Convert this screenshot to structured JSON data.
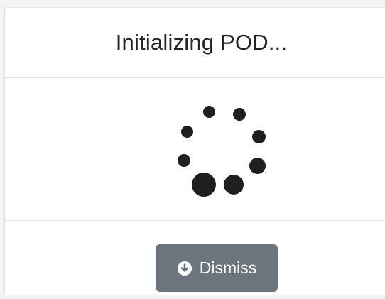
{
  "modal": {
    "title": "Initializing POD...",
    "dismiss_label": "Dismiss",
    "dismiss_icon": "arrow-circle-down-icon",
    "spinner_icon": "loading-spinner-icon"
  },
  "colors": {
    "button_bg": "#6c757d",
    "spinner": "#1f1f1f",
    "divider": "#dee2e6"
  }
}
